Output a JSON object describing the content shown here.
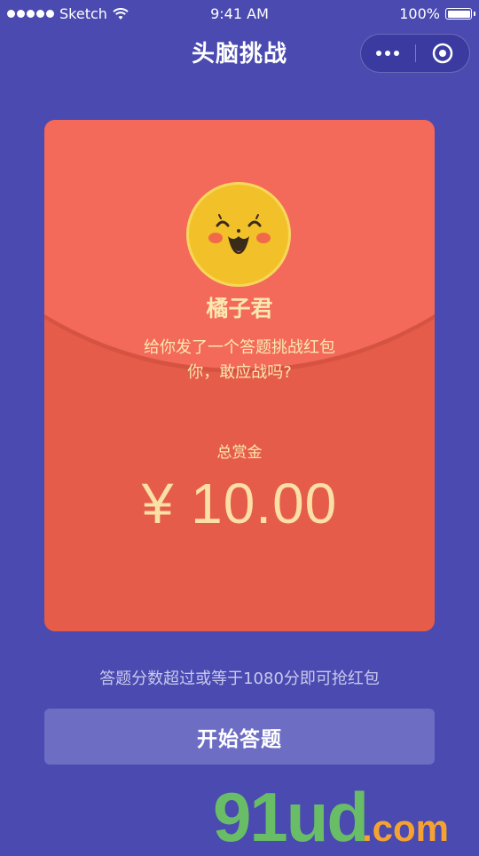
{
  "status_bar": {
    "carrier": "Sketch",
    "time": "9:41 AM",
    "battery": "100%"
  },
  "nav": {
    "title": "头脑挑战",
    "more_icon": "more-dots-icon",
    "close_icon": "target-circle-icon"
  },
  "envelope": {
    "sender_name": "橘子君",
    "message_line1": "给你发了一个答题挑战红包",
    "message_line2": "你，敢应战吗?",
    "reward_label": "总赏金",
    "reward_amount": "¥ 10.00",
    "avatar_icon": "smiley-face-icon"
  },
  "rule_text": "答题分数超过或等于1080分即可抢红包",
  "start_button_label": "开始答题",
  "watermark": {
    "main": "91ud",
    "sub": ".com"
  },
  "colors": {
    "background": "#4a4ab0",
    "card": "#e55d4a",
    "card_flap": "#f3695a",
    "accent_text": "#fbe7b0",
    "button": "#6d6dc4"
  }
}
